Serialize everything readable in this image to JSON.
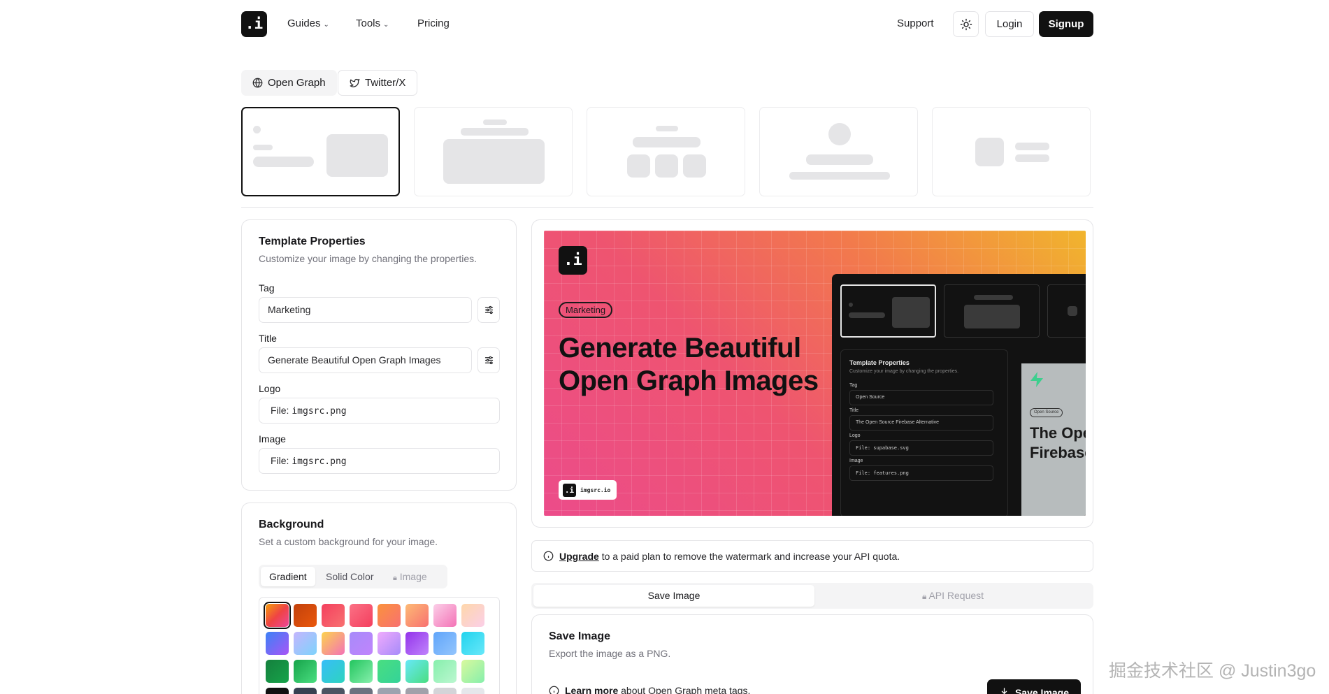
{
  "header": {
    "logo": ".i",
    "nav": [
      {
        "label": "Guides",
        "has_dropdown": true
      },
      {
        "label": "Tools",
        "has_dropdown": true
      },
      {
        "label": "Pricing",
        "has_dropdown": false
      }
    ],
    "support_label": "Support",
    "theme_icon": "sun-icon",
    "login_label": "Login",
    "signup_label": "Signup"
  },
  "platform_tabs": {
    "open_graph": {
      "label": "Open Graph",
      "icon": "globe-icon"
    },
    "twitter": {
      "label": "Twitter/X",
      "icon": "twitter-icon"
    }
  },
  "templates": [
    "template-1",
    "template-2",
    "template-3",
    "template-4",
    "template-5"
  ],
  "template_properties": {
    "title": "Template Properties",
    "subtitle": "Customize your image by changing the properties.",
    "tag_label": "Tag",
    "tag_value": "Marketing",
    "title_label": "Title",
    "title_value": "Generate Beautiful Open Graph Images",
    "logo_label": "Logo",
    "logo_file_prefix": "File:",
    "logo_file": "imgsrc.png",
    "image_label": "Image",
    "image_file_prefix": "File:",
    "image_file": "imgsrc.png"
  },
  "background": {
    "title": "Background",
    "subtitle": "Set a custom background for your image.",
    "tabs": {
      "gradient": "Gradient",
      "solid": "Solid Color",
      "image": "Image"
    }
  },
  "preview": {
    "logo": ".i",
    "tag": "Marketing",
    "title": "Generate Beautiful Open Graph Images",
    "brand_logo": ".i",
    "brand_text": "imgsrc.io",
    "screenshot": {
      "panel_title": "Template Properties",
      "panel_subtitle": "Customize your image by changing the properties.",
      "tag_label": "Tag",
      "tag_value": "Open Source",
      "title_label": "Title",
      "title_value": "The Open Source Firebase Alternative",
      "logo_label": "Logo",
      "logo_value": "File: supabase.svg",
      "image_label": "Image",
      "image_value": "File: features.png",
      "card_tag": "Open Source",
      "card_title": "The Open Source Firebase"
    }
  },
  "notice": {
    "link": "Upgrade",
    "text": "to a paid plan to remove the watermark and increase your API quota."
  },
  "actions": {
    "save_tab": "Save Image",
    "api_tab": "API Request"
  },
  "save_panel": {
    "title": "Save Image",
    "subtitle": "Export the image as a PNG.",
    "learn_link": "Learn more",
    "learn_text": "about Open Graph meta tags.",
    "button": "Save Image"
  },
  "watermark": "掘金技术社区 @ Justin3go",
  "colors": {
    "accent": "#111111",
    "border": "#e4e4e7",
    "muted": "#71717a"
  }
}
